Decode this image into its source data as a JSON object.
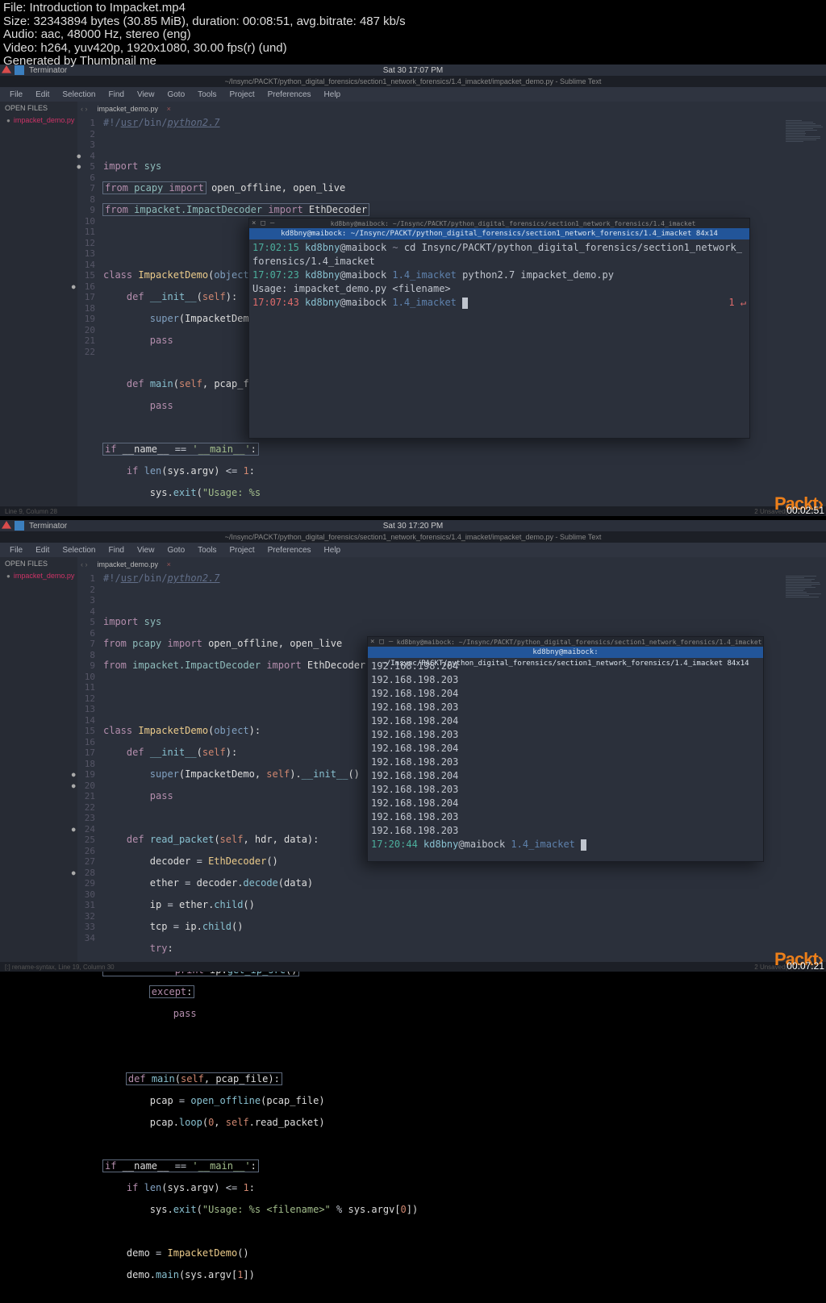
{
  "meta": {
    "file": "File: Introduction to Impacket.mp4",
    "size": "Size: 32343894 bytes (30.85 MiB), duration: 00:08:51, avg.bitrate: 487 kb/s",
    "audio": "Audio: aac, 48000 Hz, stereo (eng)",
    "video": "Video: h264, yuv420p, 1920x1080, 30.00 fps(r) (und)",
    "gen": "Generated by Thumbnail me"
  },
  "top1": {
    "topbar_title": "Terminator",
    "clock": "Sat 30  17:07 PM",
    "title_line": "~/Insync/PACKT/python_digital_forensics/section1_network_forensics/1.4_imacket/impacket_demo.py - Sublime Text",
    "status_left": "Line 9, Column 28",
    "status_right": "2 Unsaved(s) seen th..."
  },
  "top2": {
    "topbar_title": "Terminator",
    "clock": "Sat 30  17:20 PM",
    "title_line": "~/Insync/PACKT/python_digital_forensics/section1_network_forensics/1.4_imacket/impacket_demo.py - Sublime Text",
    "status_left": "[:] rename-syntax,  Line 19, Column 30",
    "status_right": "2 Unsaved(s) seen th..."
  },
  "menubar": [
    "File",
    "Edit",
    "Selection",
    "Find",
    "View",
    "Goto",
    "Tools",
    "Project",
    "Preferences",
    "Help"
  ],
  "sidebar": {
    "heading": "OPEN FILES",
    "file": "impacket_demo.py"
  },
  "tab": {
    "name": "impacket_demo.py",
    "close": "×",
    "arrows": "‹  ›"
  },
  "terminal1": {
    "head": "kd8bny@maibock: ~/Insync/PACKT/python_digital_forensics/section1_network_forensics/1.4_imacket",
    "title": "kd8bny@maibock: ~/Insync/PACKT/python_digital_forensics/section1_network_forensics/1.4_imacket 84x14",
    "lines": [
      {
        "t": "17:02:15",
        "u": "kd8bny",
        "h": "@maibock",
        "s": "~",
        "cmd": "cd Insync/PACKT/python_digital_forensics/section1_network_"
      },
      {
        "cont": "forensics/1.4_imacket"
      },
      {
        "t": "17:07:23",
        "u": "kd8bny",
        "h": "@maibock",
        "p": "1.4_imacket",
        "cmd": "python2.7 impacket_demo.py"
      },
      {
        "plain": "Usage: impacket_demo.py <filename>"
      },
      {
        "t": "17:07:43",
        "tcls": "t-time2",
        "u": "kd8bny",
        "h": "@maibock",
        "p": "1.4_imacket",
        "right": "1 ↵"
      }
    ]
  },
  "terminal2": {
    "head": "kd8bny@maibock: ~/Insync/PACKT/python_digital_forensics/section1_network_forensics/1.4_imacket",
    "title": "kd8bny@maibock: ~/Insync/PACKT/python_digital_forensics/section1_network_forensics/1.4_imacket 84x14",
    "ips": [
      "192.168.198.204",
      "192.168.198.203",
      "192.168.198.204",
      "192.168.198.203",
      "192.168.198.204",
      "192.168.198.203",
      "192.168.198.204",
      "192.168.198.203",
      "192.168.198.204",
      "192.168.198.203",
      "192.168.198.204",
      "192.168.198.203",
      "192.168.198.203"
    ],
    "prompt": {
      "t": "17:20:44",
      "u": "kd8bny",
      "h": "@maibock",
      "p": "1.4_imacket"
    }
  },
  "timestamps": {
    "frame1": "00:02:51",
    "frame2": "00:07:21"
  },
  "packt": "Packt›"
}
